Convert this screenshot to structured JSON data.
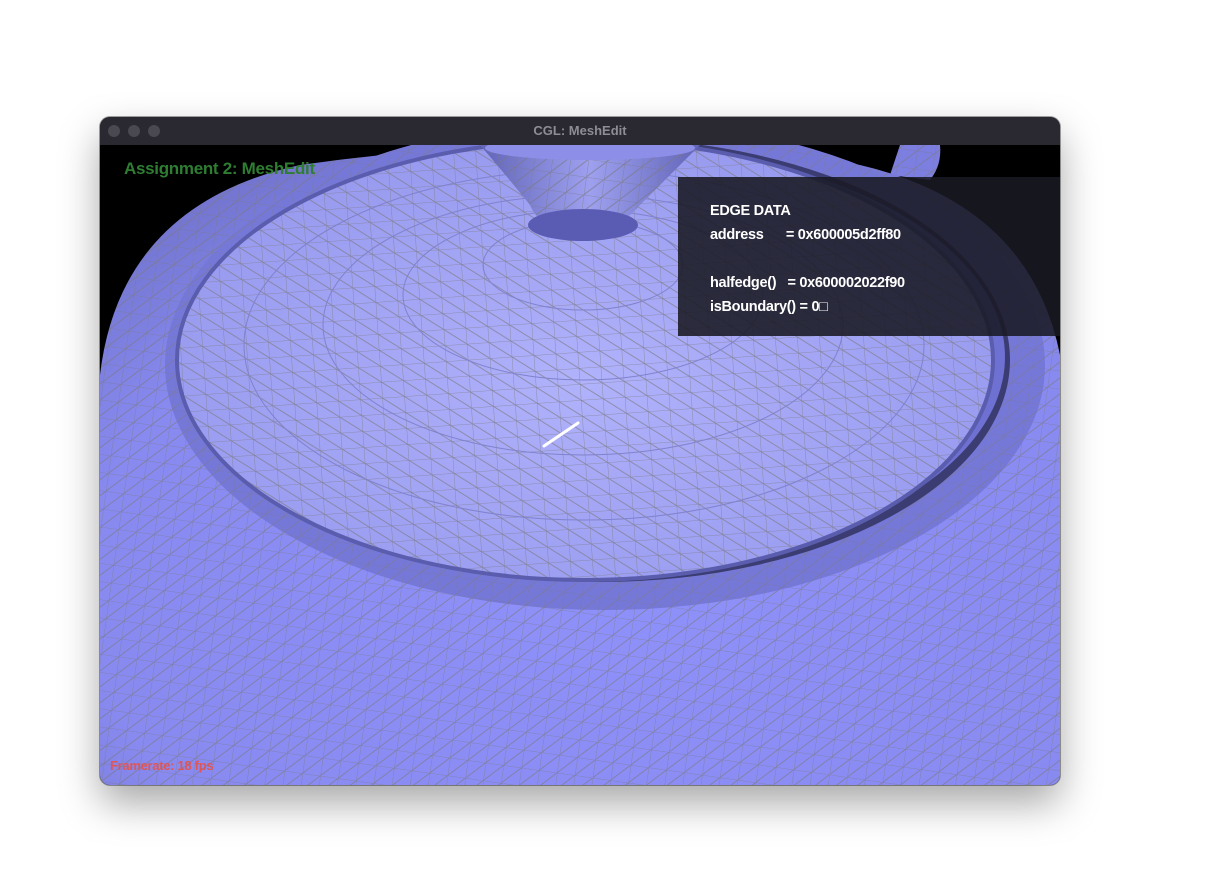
{
  "window": {
    "title": "CGL: MeshEdit"
  },
  "app": {
    "title": "Assignment 2: MeshEdit"
  },
  "edge_panel": {
    "heading": "EDGE DATA",
    "address_line": "address      = 0x600005d2ff80",
    "halfedge_line": "halfedge()   = 0x600002022f90",
    "boundary_line": "isBoundary() = 0□"
  },
  "status": {
    "framerate": "Framerate:  18 fps"
  },
  "colors": {
    "mesh_fill": "#9a9cf5",
    "wireframe": "#7f7f86",
    "selected_edge": "#ffffff",
    "title_green": "#2e7d32",
    "framerate_red": "#e05555"
  }
}
